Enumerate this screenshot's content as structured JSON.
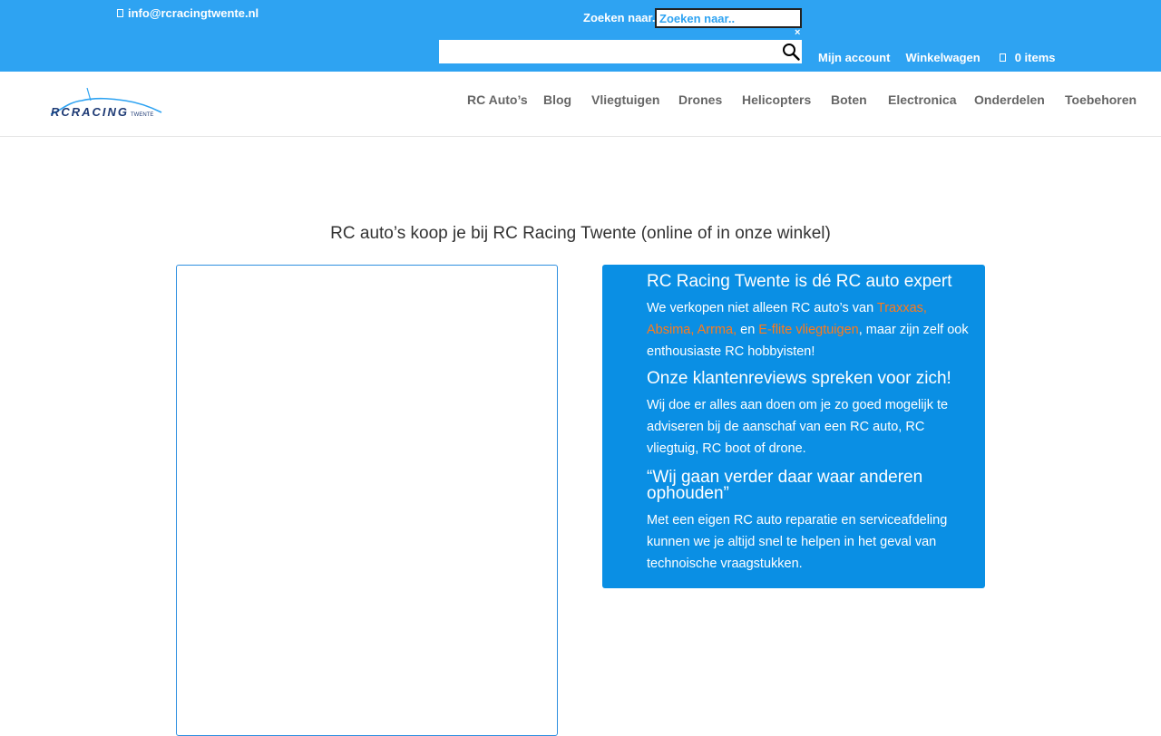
{
  "topbar": {
    "email": "info@rcracingtwente.nl",
    "search_label": "Zoeken naar..",
    "search_value": "Zoeken naar..",
    "close": "×",
    "links": {
      "account": "Mijn account",
      "cart": "Winkelwagen",
      "items": "0 items"
    }
  },
  "nav": {
    "items": [
      "RC Auto’s",
      "Blog",
      "Vliegtuigen",
      "Drones",
      "Helicopters",
      "Boten",
      "Electronica",
      "Onderdelen",
      "Toebehoren"
    ]
  },
  "main": {
    "headline": "RC auto’s koop je bij RC Racing Twente (online of in onze winkel)",
    "info": {
      "title1": "RC Racing Twente is dé RC auto expert",
      "p1_pre": "We verkopen niet alleen RC auto’s van ",
      "p1_link1": "Traxxas, Absima, Arrma,",
      "p1_mid": " en ",
      "p1_link2": "E-flite vliegtuigen",
      "p1_post": ", maar zijn zelf ook enthousiaste RC hobbyisten!",
      "title2": "Onze klantenreviews spreken voor zich!",
      "p2": "Wij doe er alles aan doen om je zo goed mogelijk te adviseren bij de aanschaf van een RC auto, RC vliegtuig, RC boot of drone.",
      "title3": "“Wij gaan verder daar waar anderen ophouden”",
      "p3": "Met een eigen RC auto reparatie en serviceafdeling kunnen we je altijd snel te helpen in het geval van technoische vraagstukken."
    }
  },
  "colors": {
    "topbar": "#2ea3f2",
    "info_box": "#0a8fe4",
    "link": "#ff7a1a",
    "nav_text": "#666666"
  },
  "icons": [
    "envelope-icon",
    "search-icon",
    "cart-icon",
    "logo"
  ]
}
